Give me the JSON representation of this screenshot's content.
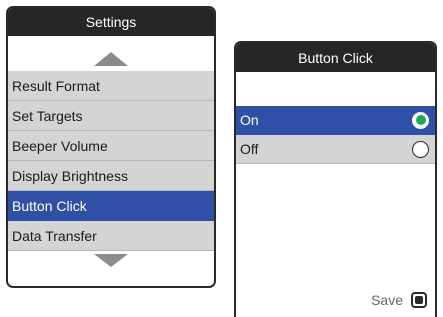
{
  "settings_screen": {
    "title": "Settings",
    "menu_items": [
      {
        "label": "Result Format"
      },
      {
        "label": "Set Targets"
      },
      {
        "label": "Beeper Volume"
      },
      {
        "label": "Display Brightness"
      },
      {
        "label": "Button Click",
        "selected": true
      },
      {
        "label": "Data Transfer"
      }
    ],
    "icons": {
      "up": "scroll-up-arrow",
      "down": "scroll-down-arrow"
    }
  },
  "button_click_screen": {
    "title": "Button Click",
    "options": [
      {
        "label": "On",
        "checked": true
      },
      {
        "label": "Off",
        "checked": false
      }
    ],
    "save_label": "Save"
  },
  "colors": {
    "title_bar": "#262626",
    "selected_row": "#2f50a6",
    "row_bg": "#d4d4d4",
    "radio_checked": "#1fa856"
  }
}
